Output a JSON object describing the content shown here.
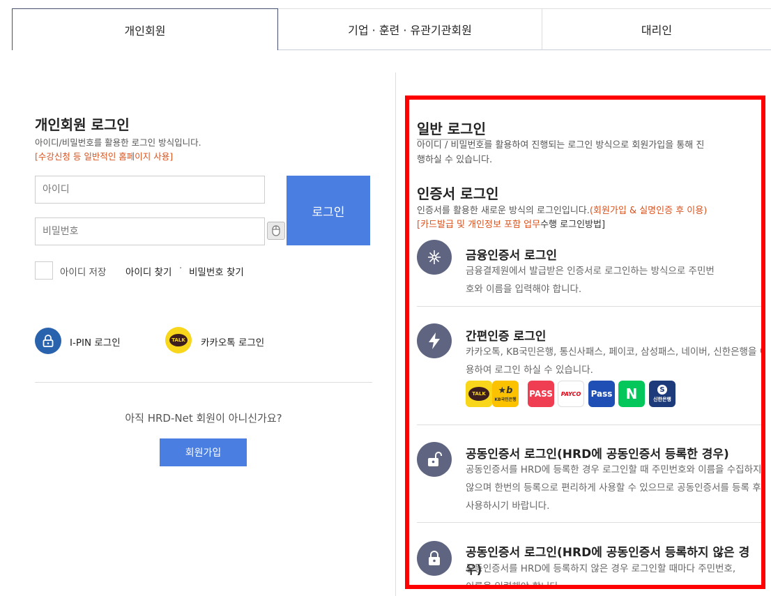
{
  "tabs": [
    {
      "label": "개인회원"
    },
    {
      "label": "기업 · 훈련 · 유관기관회원"
    },
    {
      "label": "대리인"
    }
  ],
  "left": {
    "title": "개인회원 로그인",
    "desc": "아이디/비밀번호를 활용한 로그인 방식입니다.",
    "note": "[수강신청 등 일반적인 홈페이지 사용]",
    "id_placeholder": "아이디",
    "pw_placeholder": "비밀번호",
    "login_button": "로그인",
    "save_id_label": "아이디 저장",
    "find_id": "아이디 찾기",
    "find_sep": "·",
    "find_pw": "비밀번호 찾기",
    "ipin_label": "I-PIN 로그인",
    "kakao_label": "카카오톡 로그인",
    "kakao_icon_text": "TALK",
    "join_question": "아직 HRD-Net 회원이 아니신가요?",
    "join_button": "회원가입"
  },
  "right": {
    "general_title": "일반 로그인",
    "general_desc": "아이디 / 비밀번호를 활용하여 진행되는 로그인 방식으로 회원가입을 통해 진행하실 수 있습니다.",
    "cert_title": "인증서 로그인",
    "cert_desc": "인증서를 활용한 새로운 방식의 로그인입니다.",
    "cert_desc_orange": "(회원가입 & 실명인증 후 이용)",
    "cert_note_orange": "[카드발급 및 개인정보 포함 업무",
    "cert_note_rest": "수행 로그인방법]",
    "items": [
      {
        "title": "금융인증서 로그인",
        "desc": "금융결제원에서 발급받은 인증서로 로그인하는 방식으로 주민번호와 이름을 입력해야 합니다."
      },
      {
        "title": "간편인증 로그인",
        "desc": "카카오톡, KB국민은행, 통신사패스, 페이코, 삼성패스, 네이버, 신한은행을 이용하여 로그인 하실 수 있습니다."
      },
      {
        "title": "공동인증서 로그인(HRD에 공동인증서 등록한 경우)",
        "desc": "공동인증서를 HRD에 등록한 경우 로그인할 때 주민번호와 이름을 수집하지 않으며 한번의 등록으로 편리하게 사용할 수 있으므로 공동인증서를 등록 후 사용하시기 바랍니다."
      },
      {
        "title": "공동인증서 로그인(HRD에 공동인증서 등록하지 않은 경우)",
        "desc": "공동인증서를 HRD에 등록하지 않은 경우 로그인할 때마다 주민번호, 이름을 입력해야 합니다."
      }
    ],
    "providers": [
      {
        "name": "kakao",
        "text": "TALK",
        "color": "#f7d61c"
      },
      {
        "name": "kb",
        "text": "KB국민은행",
        "color": "#fcc200"
      },
      {
        "name": "pass",
        "text": "PASS",
        "color": "#ef3e52"
      },
      {
        "name": "payco",
        "text": "PAYCO",
        "color": "#ffffff"
      },
      {
        "name": "samsung-pass",
        "text": "Pass",
        "color": "#1f4fb5"
      },
      {
        "name": "naver",
        "text": "N",
        "color": "#03c75a"
      },
      {
        "name": "shinhan",
        "text": "신한은행",
        "color": "#1d3a7a"
      }
    ]
  }
}
